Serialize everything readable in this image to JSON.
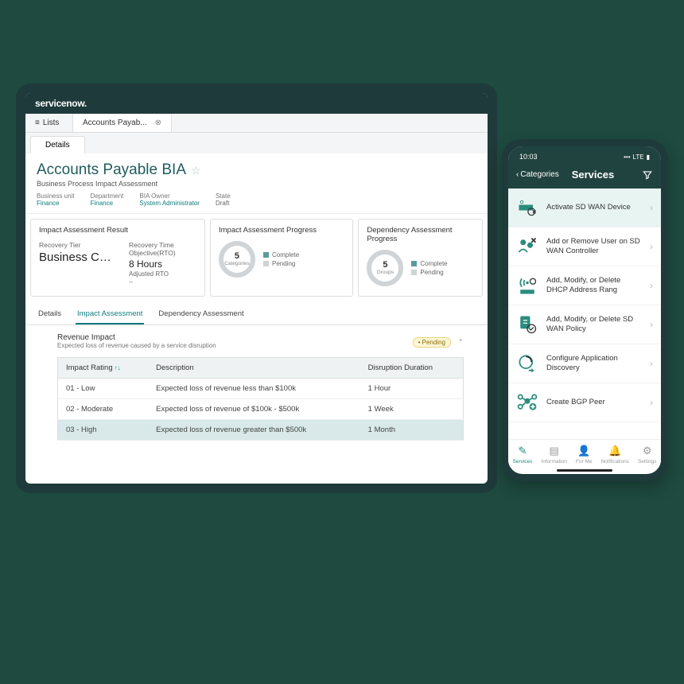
{
  "branding": {
    "logo": "servicenow."
  },
  "breadcrumbs": {
    "lists": "Lists",
    "current": "Accounts Payab..."
  },
  "subtab": {
    "details": "Details"
  },
  "header": {
    "title": "Accounts Payable BIA",
    "subtitle": "Business Process Impact Assessment",
    "meta": {
      "bu_label": "Business unit",
      "bu": "Finance",
      "dept_label": "Department",
      "dept": "Finance",
      "owner_label": "BIA Owner",
      "owner": "System Administrator",
      "state_label": "State",
      "state": "Draft"
    }
  },
  "panels": {
    "result": {
      "title": "Impact Assessment Result",
      "tier_label": "Recovery Tier",
      "tier": "Business Crit...",
      "rto_label": "Recovery Time Objective(RTO)",
      "rto": "8 Hours",
      "adj_label": "Adjusted RTO",
      "adj": "--"
    },
    "progress": {
      "title": "Impact Assessment Progress",
      "count": "5",
      "count_label": "Categories",
      "complete": "Complete",
      "pending": "Pending"
    },
    "dep": {
      "title": "Dependency Assessment Progress",
      "count": "5",
      "count_label": "Groups",
      "complete": "Complete",
      "pending": "Pending"
    }
  },
  "ctabs": {
    "details": "Details",
    "impact": "Impact Assessment",
    "dep": "Dependency Assessment"
  },
  "revenue": {
    "title": "Revenue Impact",
    "sub": "Expected loss of revenue caused by a service disruption",
    "badge": "• Pending",
    "cols": {
      "rating": "Impact Rating",
      "desc": "Description",
      "dur": "Disruption Duration"
    },
    "rows": [
      {
        "rating": "01 - Low",
        "desc": "Expected loss of revenue less than $100k",
        "dur": "1 Hour"
      },
      {
        "rating": "02 - Moderate",
        "desc": "Expected loss of revenue of $100k - $500k",
        "dur": "1 Week"
      },
      {
        "rating": "03 - High",
        "desc": "Expected loss of revenue greater than $500k",
        "dur": "1 Month"
      }
    ]
  },
  "phone": {
    "time": "10:03",
    "signal": "LTE",
    "back": "Categories",
    "title": "Services",
    "items": [
      "Activate SD WAN Device",
      "Add or Remove User on SD WAN Controller",
      "Add, Modify, or Delete DHCP Address Rang",
      "Add, Modify, or Delete SD WAN Policy",
      "Configure Application Discovery",
      "Create BGP Peer"
    ],
    "nav": {
      "services": "Services",
      "info": "Information",
      "forme": "For Me",
      "notif": "Notifications",
      "settings": "Settings"
    }
  }
}
